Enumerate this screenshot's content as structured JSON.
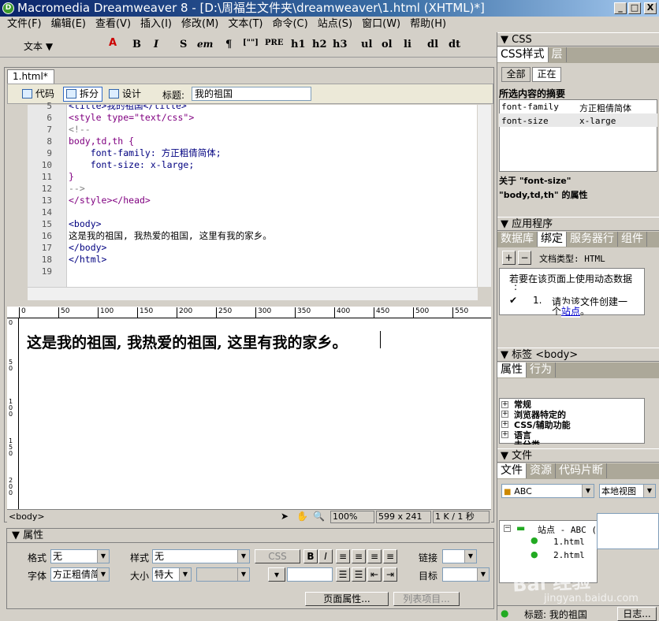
{
  "window": {
    "title": "Macromedia Dreamweaver 8 - [D:\\周福生文件夹\\dreamweaver\\1.html (XHTML)*]",
    "logo_letter": "D",
    "minimize": "_",
    "maximize": "□",
    "close": "X"
  },
  "menu": [
    "文件(F)",
    "编辑(E)",
    "查看(V)",
    "插入(I)",
    "修改(M)",
    "文本(T)",
    "命令(C)",
    "站点(S)",
    "窗口(W)",
    "帮助(H)"
  ],
  "insert_toolbar": {
    "category": "文本 ▼",
    "items": [
      "B",
      "I",
      "S",
      "em",
      "¶",
      "[\"\"]",
      "PRE",
      "h1",
      "h2",
      "h3",
      "ul",
      "ol",
      "li",
      "dl",
      "dt"
    ]
  },
  "document": {
    "tab": "1.html*",
    "views": {
      "code": "代码",
      "split": "拆分",
      "design": "设计"
    },
    "title_label": "标题:",
    "title_value": "我的祖国",
    "code_lines": [
      {
        "n": "5",
        "text": "<title>我的祖国</title>",
        "color": "#000080"
      },
      {
        "n": "6",
        "text": "<style type=\"text/css\">",
        "color": "#800080"
      },
      {
        "n": "7",
        "text": "<!--",
        "color": "#808080"
      },
      {
        "n": "8",
        "text": "body,td,th {",
        "color": "#800080"
      },
      {
        "n": "9",
        "text": "    font-family: 方正粗倩简体;",
        "color": "#000080"
      },
      {
        "n": "10",
        "text": "    font-size: x-large;",
        "color": "#000080"
      },
      {
        "n": "11",
        "text": "}",
        "color": "#800080"
      },
      {
        "n": "12",
        "text": "-->",
        "color": "#808080"
      },
      {
        "n": "13",
        "text": "</style></head>",
        "color": "#800080"
      },
      {
        "n": "14",
        "text": "",
        "color": "#000"
      },
      {
        "n": "15",
        "text": "<body>",
        "color": "#000080"
      },
      {
        "n": "16",
        "text": "这是我的祖国, 我热爱的祖国, 这里有我的家乡。",
        "color": "#000"
      },
      {
        "n": "17",
        "text": "</body>",
        "color": "#000080"
      },
      {
        "n": "18",
        "text": "</html>",
        "color": "#000080"
      },
      {
        "n": "19",
        "text": "",
        "color": "#000"
      }
    ],
    "ruler_marks": [
      "0",
      "50",
      "100",
      "150",
      "200",
      "250",
      "300",
      "350",
      "400",
      "450",
      "500",
      "550"
    ],
    "vruler_marks": [
      "0",
      "50",
      "100",
      "150",
      "200"
    ],
    "design_text": "这是我的祖国, 我热爱的祖国, 这里有我的家乡。",
    "status": {
      "tag": "<body>",
      "zoom": "100%",
      "size": "599 x 241",
      "download": "1 K / 1 秒"
    }
  },
  "properties": {
    "header": "▼ 属性",
    "format_label": "格式",
    "format_value": "无",
    "style_label": "样式",
    "style_value": "无",
    "css_btn": "CSS",
    "bold": "B",
    "italic": "I",
    "link_label": "链接",
    "font_label": "字体",
    "font_value": "方正粗倩简",
    "size_label": "大小",
    "size_value": "特大",
    "target_label": "目标",
    "page_props": "页面属性...",
    "list_item": "列表项目..."
  },
  "css_panel": {
    "header": "▼ CSS",
    "tabs": [
      "CSS样式",
      "层"
    ],
    "mode_all": "全部",
    "mode_current": "正在",
    "summary_title": "所选内容的摘要",
    "rows": [
      {
        "prop": "font-family",
        "val": "方正粗倩简体"
      },
      {
        "prop": "font-size",
        "val": "x-large"
      }
    ],
    "about": "关于 \"font-size\"",
    "rule": "\"body,td,th\" 的属性"
  },
  "app_panel": {
    "header": "▼ 应用程序",
    "tabs": [
      "数据库",
      "绑定",
      "服务器行",
      "组件"
    ],
    "doctype": "文档类型: HTML",
    "msg1": "若要在该页面上使用动态数据",
    "msg1b": ":",
    "step": "1.",
    "msg2": "请为该文件创建一",
    "msg3": "个站点。",
    "link": "站点"
  },
  "tag_panel": {
    "header": "▼ 标签 <body>",
    "tabs": [
      "属性",
      "行为"
    ],
    "groups": [
      "常规",
      "浏览器特定的",
      "CSS/辅助功能",
      "语言",
      "未分类"
    ]
  },
  "files_panel": {
    "header": "▼ 文件",
    "tabs": [
      "文件",
      "资源",
      "代码片断"
    ],
    "site": "ABC",
    "view": "本地视图",
    "root": "站点 - ABC (",
    "files": [
      "1.html",
      "2.html"
    ]
  },
  "bottom_status": {
    "title": "标题: 我的祖国",
    "log": "日志..."
  },
  "watermark": {
    "main": "Bai 经验",
    "sub": "jingyan.baidu.com"
  },
  "colors": {
    "titlebar": "#0a246a",
    "chrome": "#d4d0c8",
    "selection": "#316ac5"
  }
}
